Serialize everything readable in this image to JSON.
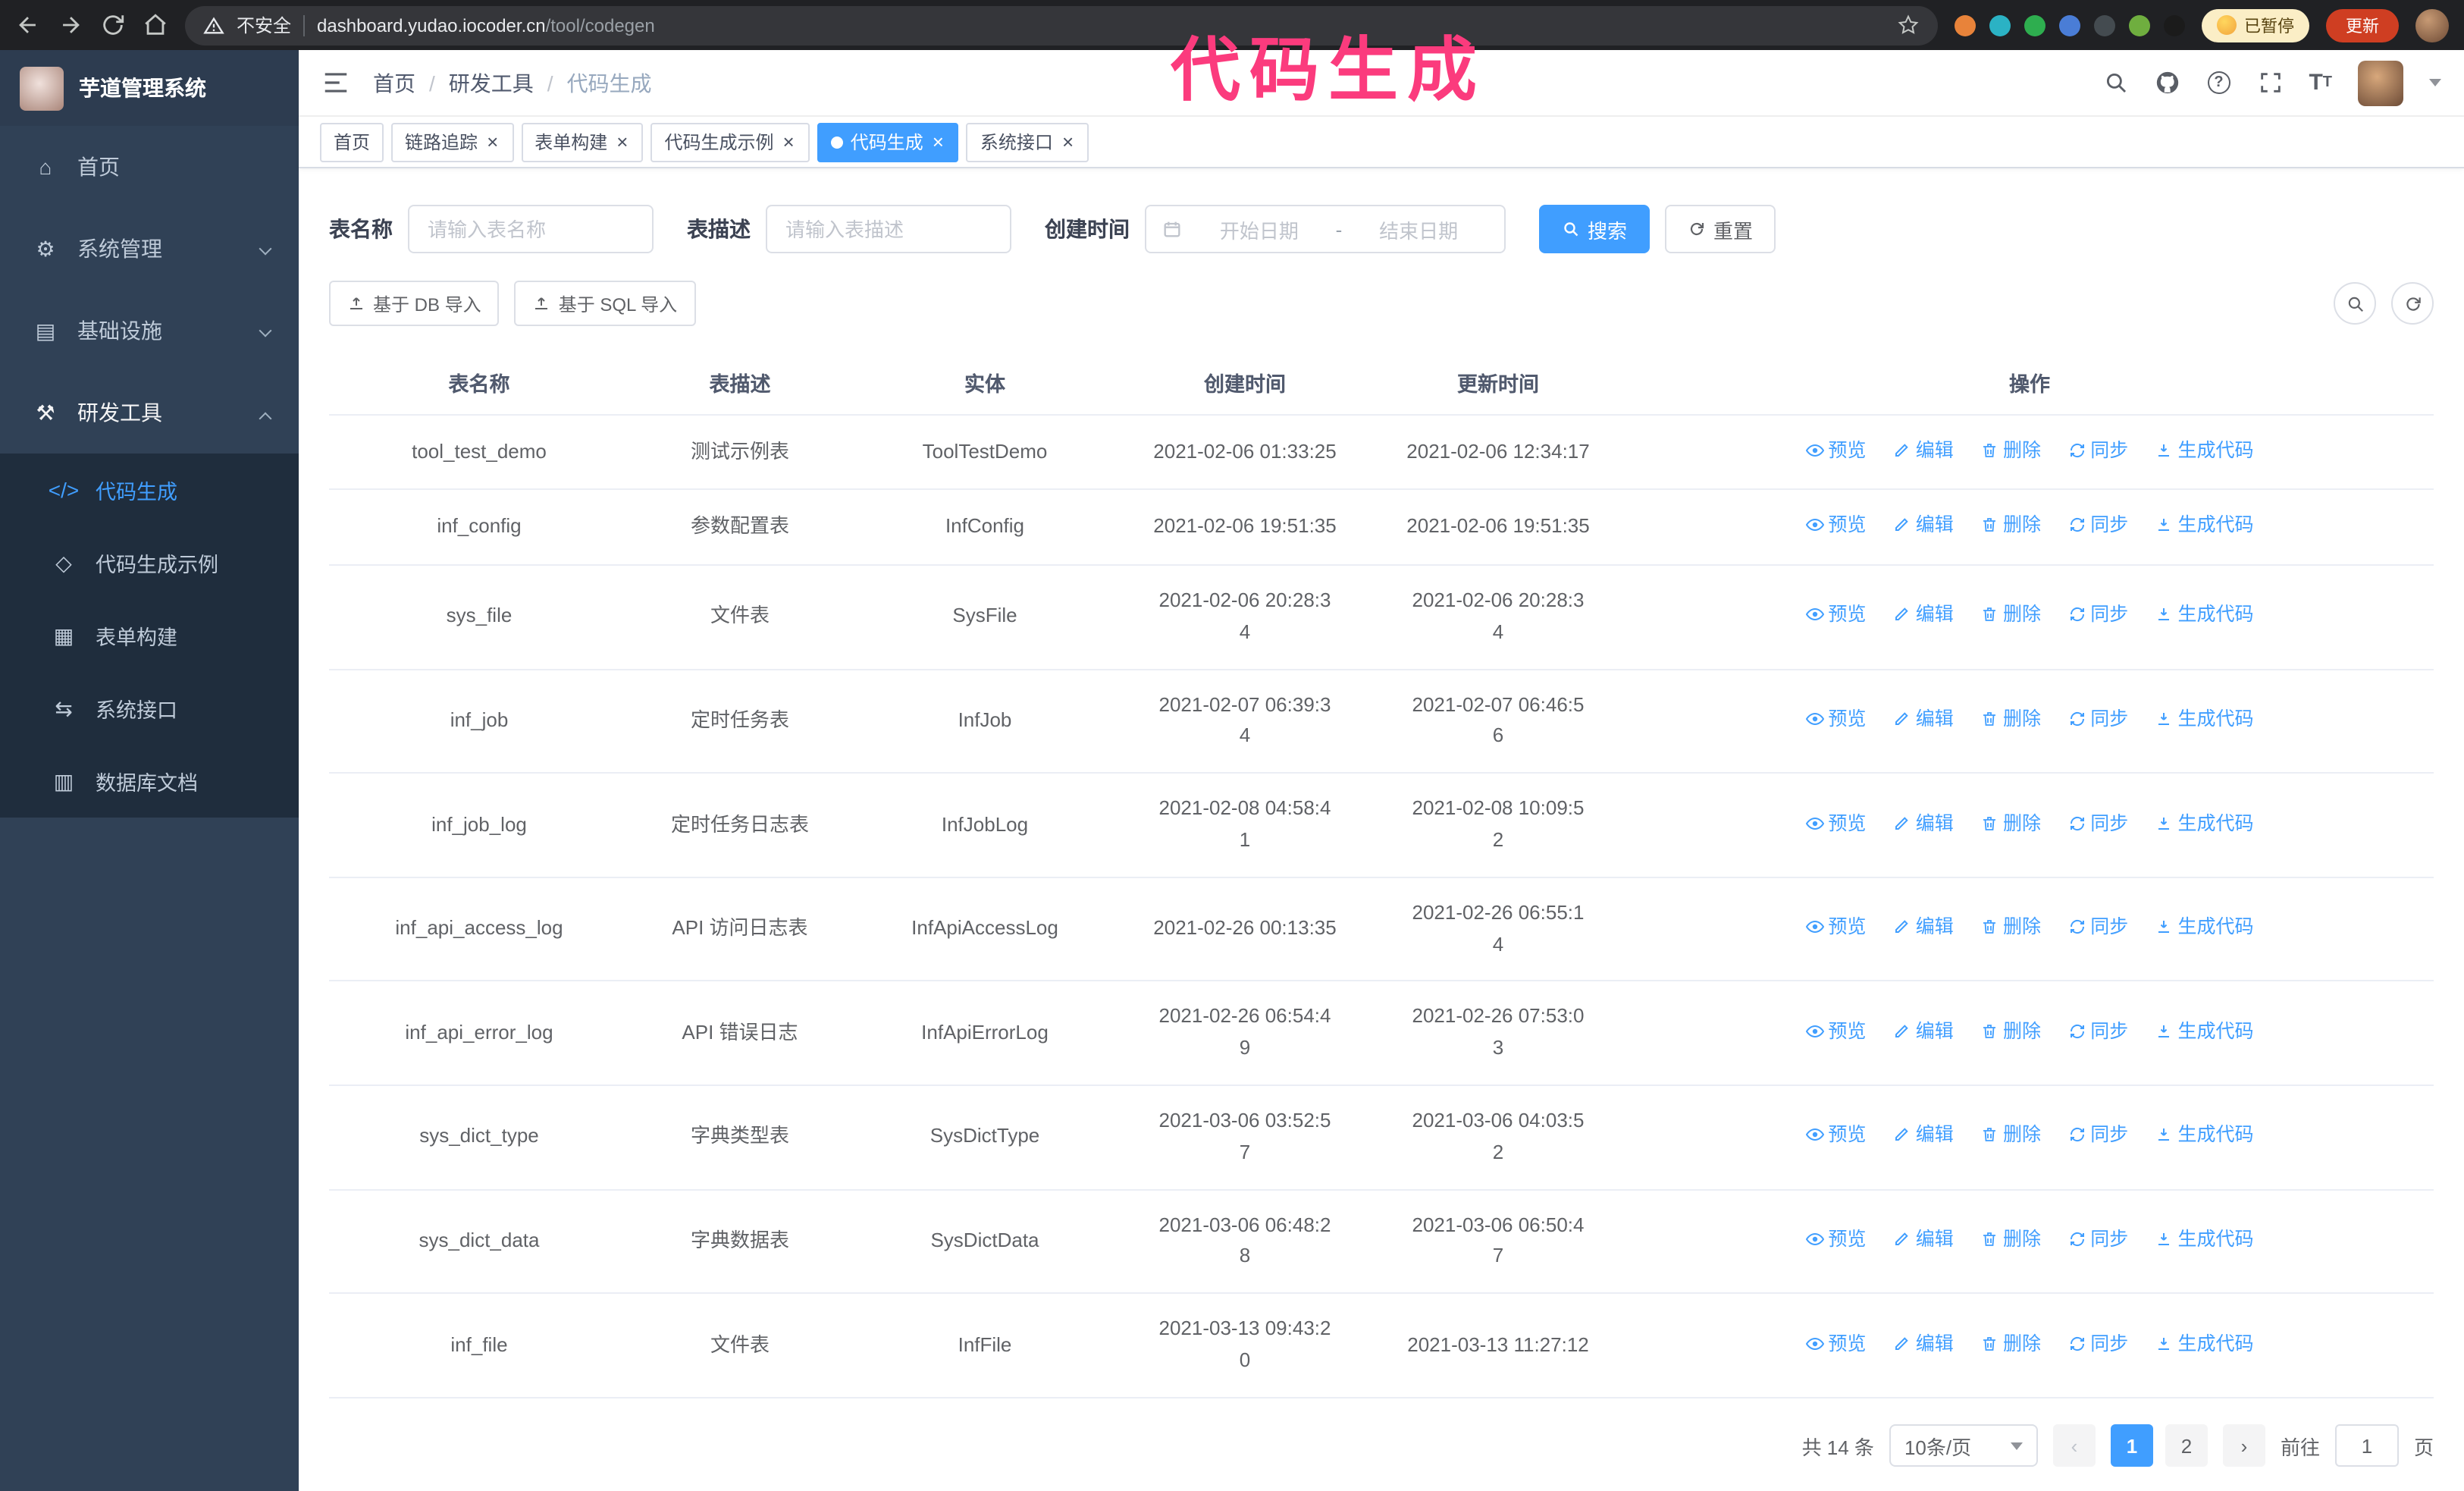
{
  "annotation": {
    "text": "代码生成"
  },
  "browser": {
    "security_label": "不安全",
    "url_domain": "dashboard.yudao.iocoder.cn",
    "url_path": "/tool/codegen",
    "extension_colors": [
      "#e8833a",
      "#2bb2c4",
      "#2eae4f",
      "#4a7dd6",
      "#444b50",
      "#6fae3f",
      "#1b1b1b"
    ],
    "paused_badge": "已暂停",
    "update_button": "更新"
  },
  "sidebar": {
    "logo_title": "芋道管理系统",
    "items": [
      {
        "id": "home",
        "icon": "home",
        "label": "首页"
      },
      {
        "id": "system-management",
        "icon": "system",
        "label": "系统管理",
        "expanded": false
      },
      {
        "id": "infrastructure",
        "icon": "infra",
        "label": "基础设施",
        "expanded": false
      },
      {
        "id": "dev-tools",
        "icon": "tools",
        "label": "研发工具",
        "expanded": true
      }
    ],
    "sub_items": [
      {
        "id": "codegen",
        "icon": "code",
        "label": "代码生成",
        "active": true
      },
      {
        "id": "codegen-example",
        "icon": "example",
        "label": "代码生成示例",
        "active": false
      },
      {
        "id": "form-builder",
        "icon": "form",
        "label": "表单构建",
        "active": false
      },
      {
        "id": "system-api",
        "icon": "api",
        "label": "系统接口",
        "active": false
      },
      {
        "id": "db-doc",
        "icon": "db",
        "label": "数据库文档",
        "active": false
      }
    ]
  },
  "header": {
    "breadcrumb": [
      "首页",
      "研发工具",
      "代码生成"
    ],
    "separator": "/"
  },
  "tabs": [
    {
      "label": "首页",
      "closable": false,
      "active": false
    },
    {
      "label": "链路追踪",
      "closable": true,
      "active": false
    },
    {
      "label": "表单构建",
      "closable": true,
      "active": false
    },
    {
      "label": "代码生成示例",
      "closable": true,
      "active": false
    },
    {
      "label": "代码生成",
      "closable": true,
      "active": true
    },
    {
      "label": "系统接口",
      "closable": true,
      "active": false
    }
  ],
  "filters": {
    "table_name_label": "表名称",
    "table_name_placeholder": "请输入表名称",
    "table_desc_label": "表描述",
    "table_desc_placeholder": "请输入表描述",
    "create_time_label": "创建时间",
    "date_start_placeholder": "开始日期",
    "date_separator": "-",
    "date_end_placeholder": "结束日期",
    "search_button": "搜索",
    "reset_button": "重置"
  },
  "toolbar": {
    "import_db_button": "基于 DB 导入",
    "import_sql_button": "基于 SQL 导入"
  },
  "table": {
    "columns": [
      "表名称",
      "表描述",
      "实体",
      "创建时间",
      "更新时间",
      "操作"
    ],
    "actions": [
      "预览",
      "编辑",
      "删除",
      "同步",
      "生成代码"
    ],
    "rows": [
      {
        "name": "tool_test_demo",
        "desc": "测试示例表",
        "entity": "ToolTestDemo",
        "create_time": "2021-02-06 01:33:25",
        "update_time": "2021-02-06 12:34:17"
      },
      {
        "name": "inf_config",
        "desc": "参数配置表",
        "entity": "InfConfig",
        "create_time": "2021-02-06 19:51:35",
        "update_time": "2021-02-06 19:51:35"
      },
      {
        "name": "sys_file",
        "desc": "文件表",
        "entity": "SysFile",
        "create_time": "2021-02-06 20:28:3\n4",
        "update_time": "2021-02-06 20:28:3\n4"
      },
      {
        "name": "inf_job",
        "desc": "定时任务表",
        "entity": "InfJob",
        "create_time": "2021-02-07 06:39:3\n4",
        "update_time": "2021-02-07 06:46:5\n6"
      },
      {
        "name": "inf_job_log",
        "desc": "定时任务日志表",
        "entity": "InfJobLog",
        "create_time": "2021-02-08 04:58:4\n1",
        "update_time": "2021-02-08 10:09:5\n2"
      },
      {
        "name": "inf_api_access_log",
        "desc": "API 访问日志表",
        "entity": "InfApiAccessLog",
        "create_time": "2021-02-26 00:13:35",
        "update_time": "2021-02-26 06:55:1\n4"
      },
      {
        "name": "inf_api_error_log",
        "desc": "API 错误日志",
        "entity": "InfApiErrorLog",
        "create_time": "2021-02-26 06:54:4\n9",
        "update_time": "2021-02-26 07:53:0\n3"
      },
      {
        "name": "sys_dict_type",
        "desc": "字典类型表",
        "entity": "SysDictType",
        "create_time": "2021-03-06 03:52:5\n7",
        "update_time": "2021-03-06 04:03:5\n2"
      },
      {
        "name": "sys_dict_data",
        "desc": "字典数据表",
        "entity": "SysDictData",
        "create_time": "2021-03-06 06:48:2\n8",
        "update_time": "2021-03-06 06:50:4\n7"
      },
      {
        "name": "inf_file",
        "desc": "文件表",
        "entity": "InfFile",
        "create_time": "2021-03-13 09:43:2\n0",
        "update_time": "2021-03-13 11:27:12"
      }
    ]
  },
  "pagination": {
    "total_text": "共 14 条",
    "page_size": "10条/页",
    "pages": [
      "1",
      "2"
    ],
    "active_page": "1",
    "goto_label": "前往",
    "goto_value": "1",
    "goto_suffix": "页"
  },
  "colors": {
    "accent": "#409eff",
    "annotation": "#fb3b7d",
    "sidebar_bg": "#304156",
    "submenu_bg": "#1f2d3d",
    "update_button_bg": "#cf3e22",
    "paused_badge_bg": "#fbeec6"
  }
}
